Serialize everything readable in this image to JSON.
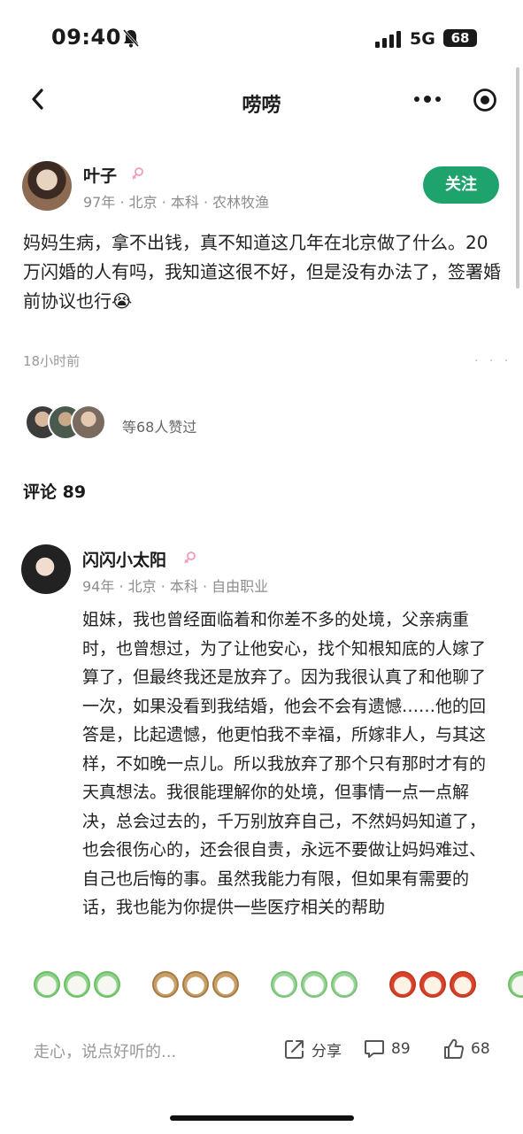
{
  "status_bar": {
    "time": "09:40",
    "network": "5G",
    "battery": "68"
  },
  "nav": {
    "title": "唠唠"
  },
  "author": {
    "name": "叶子",
    "meta": "97年 · 北京 · 本科 · 农林牧渔",
    "follow_label": "关注"
  },
  "post": {
    "text": "妈妈生病，拿不出钱，真不知道这几年在北京做了什么。20万闪婚的人有吗，我知道这很不好，但是没有办法了，签署婚前协议也行😭",
    "time": "18小时前",
    "more": "· · ·"
  },
  "likes": {
    "text": "等68人赞过"
  },
  "comments": {
    "title": "评论 89",
    "items": [
      {
        "name": "闪闪小太阳",
        "meta": "94年 · 北京 · 本科 · 自由职业",
        "text": "姐妹，我也曾经面临着和你差不多的处境，父亲病重时，也曾想过，为了让他安心，找个知根知底的人嫁了算了，但最终我还是放弃了。因为我很认真了和他聊了一次，如果没看到我结婚，他会不会有遗憾……他的回答是，比起遗憾，他更怕我不幸福，所嫁非人，与其这样，不如晚一点儿。所以我放弃了那个只有那时才有的天真想法。我很能理解你的处境，但事情一点一点解决，总会过去的，千万别放弃自己，不然妈妈知道了，也会很伤心的，还会很自责，永远不要做让妈妈难过、自己也后悔的事。虽然我能力有限，但如果有需要的话，我也能为你提供一些医疗相关的帮助"
      }
    ]
  },
  "bottom_bar": {
    "input_placeholder": "走心，说点好听的...",
    "share_label": "分享",
    "comment_count": "89",
    "like_count": "68"
  },
  "colors": {
    "accent": "#1fa36c",
    "female_icon": "#f29ac0"
  },
  "icons": [
    "bell-slash-icon",
    "signal-icon",
    "back-arrow-icon",
    "more-dots-icon",
    "target-icon",
    "female-icon",
    "share-icon",
    "comment-icon",
    "thumb-up-icon"
  ]
}
